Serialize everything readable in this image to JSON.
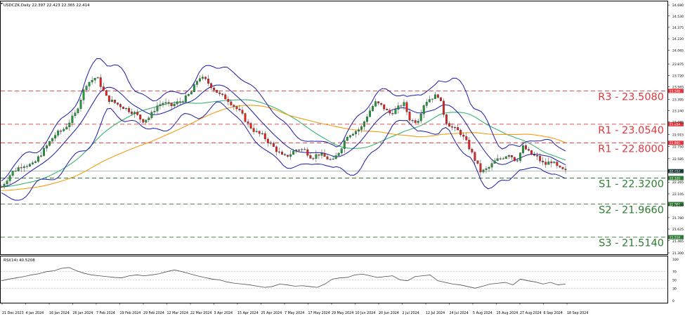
{
  "header": {
    "symbol_line": "USDCZK,Daily  22.397 22.423 22.365 22.414",
    "rsi_line": "RSI(14) 40.5208"
  },
  "colors": {
    "up": "#1f9b3a",
    "down": "#e02424",
    "band": "#1a1aa8",
    "ma_green": "#3cb371",
    "ma_orange": "#f39c12",
    "resistance": "#e0383e",
    "support": "#2e7d32",
    "rsi_line": "#4d4d4d",
    "current_tag": "#2f4f4f"
  },
  "chart_data": [
    {
      "type": "candlestick",
      "title": "USDCZK,Daily",
      "ohlc_last": {
        "open": 22.397,
        "high": 22.423,
        "low": 22.365,
        "close": 22.414
      },
      "current_price": 22.414,
      "ylim": [
        21.3,
        24.7
      ],
      "y_ticks": [
        "24.680",
        "24.530",
        "24.375",
        "24.220",
        "24.065",
        "23.875",
        "23.720",
        "23.565",
        "23.395",
        "23.240",
        "23.085",
        "22.915",
        "22.750",
        "22.585",
        "22.420",
        "22.265",
        "22.105",
        "21.950",
        "21.780",
        "21.625",
        "21.465",
        "21.300"
      ],
      "x_ticks": [
        "21 Dec 2023",
        "4 Jan 2024",
        "16 Jan 2024",
        "26 Jan 2024",
        "7 Feb 2024",
        "19 Feb 2024",
        "29 Feb 2024",
        "12 Mar 2024",
        "22 Mar 2024",
        "3 Apr 2024",
        "15 Apr 2024",
        "25 Apr 2024",
        "7 May 2024",
        "17 May 2024",
        "29 May 2024",
        "10 Jun 2024",
        "20 Jun 2024",
        "2 Jul 2024",
        "12 Jul 2024",
        "24 Jul 2024",
        "5 Aug 2024",
        "15 Aug 2024",
        "27 Aug 2024",
        "6 Sep 2024",
        "18 Sep 2024"
      ],
      "levels": [
        {
          "label": "R3 - 23.5080",
          "value": 23.508,
          "kind": "resistance",
          "tag": "23.508"
        },
        {
          "label": "R1 - 23.0540",
          "value": 23.054,
          "kind": "resistance",
          "tag": "23.054"
        },
        {
          "label": "R1 - 22.8000",
          "value": 22.8,
          "kind": "resistance",
          "tag": "22.800"
        },
        {
          "label": "S1 - 22.3200",
          "value": 22.32,
          "kind": "support",
          "tag": "22.320"
        },
        {
          "label": "S2 - 21.9660",
          "value": 21.966,
          "kind": "support",
          "tag": "21.966"
        },
        {
          "label": "S3 - 21.5140",
          "value": 21.514,
          "kind": "support",
          "tag": "21.514"
        }
      ],
      "series": [
        {
          "values_x": [
            0,
            15,
            30,
            45,
            60,
            75,
            90,
            105,
            120,
            135,
            150,
            160,
            170,
            180,
            190,
            200,
            210,
            220,
            230,
            240,
            250,
            260,
            270,
            280,
            290,
            300,
            310,
            320,
            330,
            340,
            350,
            360,
            370,
            380,
            390,
            400,
            410,
            420,
            430,
            440,
            450,
            460,
            470,
            480,
            490,
            500,
            510,
            520,
            530,
            540,
            550,
            560,
            570,
            580,
            590,
            600,
            610,
            620,
            630,
            640,
            650,
            660,
            670,
            680,
            690,
            700,
            710,
            720,
            730,
            740,
            750,
            760,
            770,
            780,
            790,
            800
          ],
          "values": [
            22.2,
            22.4,
            22.5,
            22.5,
            22.7,
            22.9,
            23.0,
            23.2,
            23.6,
            23.7,
            23.4,
            23.35,
            23.3,
            23.25,
            23.2,
            23.1,
            23.15,
            23.3,
            23.35,
            23.3,
            23.35,
            23.4,
            23.5,
            23.7,
            23.65,
            23.55,
            23.45,
            23.4,
            23.3,
            23.2,
            23.05,
            22.95,
            22.9,
            22.8,
            22.7,
            22.6,
            22.65,
            22.72,
            22.7,
            22.6,
            22.65,
            22.6,
            22.55,
            22.7,
            22.9,
            22.95,
            23.0,
            23.2,
            23.35,
            23.3,
            23.2,
            23.25,
            23.35,
            23.1,
            23.1,
            23.35,
            23.42,
            23.45,
            23.1,
            23.0,
            22.95,
            22.8,
            22.6,
            22.4,
            22.45,
            22.55,
            22.6,
            22.65,
            22.55,
            22.75,
            22.65,
            22.6,
            22.5,
            22.55,
            22.45,
            22.41
          ]
        }
      ]
    },
    {
      "type": "line",
      "title": "RSI(14) 40.5208",
      "ylim": [
        0,
        100
      ],
      "y_ticks": [
        "100",
        "70",
        "50",
        "30",
        "0"
      ],
      "series": [
        {
          "values": [
            48,
            52,
            55,
            58,
            62,
            65,
            70,
            72,
            78,
            80,
            72,
            66,
            62,
            60,
            58,
            56,
            55,
            60,
            62,
            60,
            62,
            65,
            70,
            74,
            70,
            65,
            60,
            56,
            52,
            50,
            45,
            42,
            40,
            38,
            35,
            32,
            34,
            40,
            38,
            35,
            36,
            34,
            32,
            40,
            52,
            55,
            56,
            62,
            64,
            60,
            56,
            58,
            60,
            50,
            48,
            58,
            60,
            62,
            48,
            44,
            40,
            38,
            34,
            30,
            35,
            40,
            42,
            44,
            38,
            52,
            48,
            45,
            40,
            44,
            38,
            40
          ]
        }
      ]
    }
  ]
}
